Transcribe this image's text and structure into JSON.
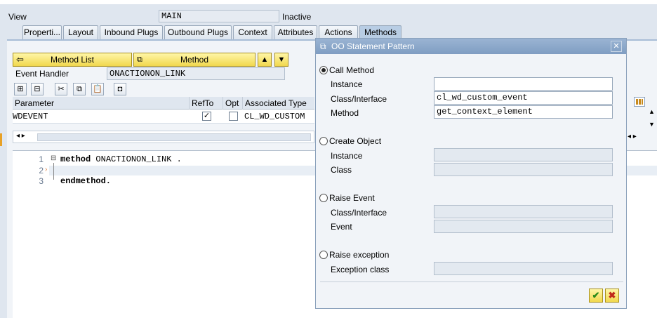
{
  "view": {
    "label": "View",
    "value": "MAIN",
    "status": "Inactive"
  },
  "tabs": [
    "Properti...",
    "Layout",
    "Inbound Plugs",
    "Outbound Plugs",
    "Context",
    "Attributes",
    "Actions",
    "Methods"
  ],
  "toolbar": {
    "method_list": "Method List",
    "method": "Method"
  },
  "event_handler": {
    "label": "Event Handler",
    "value": "ONACTIONON_LINK"
  },
  "params": {
    "headers": [
      "Parameter",
      "RefTo",
      "Opt",
      "Associated Type"
    ],
    "row": {
      "parameter": "WDEVENT",
      "assoc_type": "CL_WD_CUSTOM"
    }
  },
  "code": {
    "lines": [
      "1",
      "2",
      "3"
    ],
    "line1_kw": "method",
    "line1_rest": " ONACTIONON_LINK .",
    "line3_kw": "endmethod."
  },
  "dialog": {
    "title": "OO Statement Pattern",
    "call_method": {
      "label": "Call Method",
      "instance_label": "Instance",
      "instance_value": "",
      "class_label": "Class/Interface",
      "class_value": "cl_wd_custom_event",
      "method_label": "Method",
      "method_value": "get_context_element"
    },
    "create_object": {
      "label": "Create Object",
      "instance_label": "Instance",
      "class_label": "Class"
    },
    "raise_event": {
      "label": "Raise Event",
      "class_label": "Class/Interface",
      "event_label": "Event"
    },
    "raise_exception": {
      "label": "Raise exception",
      "exception_label": "Exception class"
    }
  }
}
